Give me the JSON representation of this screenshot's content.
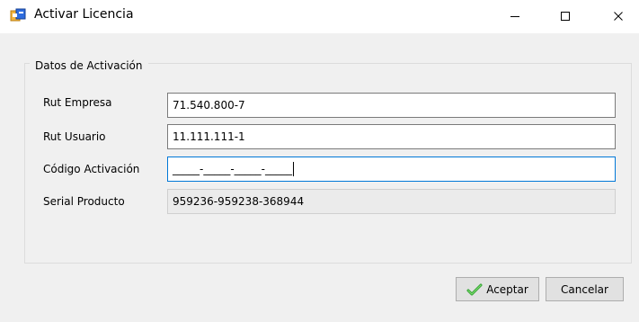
{
  "window": {
    "title": "Activar Licencia",
    "controls": {
      "minimize": "minimize-icon",
      "maximize": "maximize-icon",
      "close": "close-icon"
    }
  },
  "group": {
    "title": "Datos de Activación",
    "fields": {
      "rut_empresa": {
        "label": "Rut Empresa",
        "value": "71.540.800-7"
      },
      "rut_usuario": {
        "label": "Rut Usuario",
        "value": "11.111.111-1"
      },
      "codigo_activacion": {
        "label": "Código Activación",
        "value": "_____-_____-_____-_____"
      },
      "serial_producto": {
        "label": "Serial Producto",
        "value": "959236-959238-368944"
      }
    }
  },
  "buttons": {
    "accept": {
      "label": "Aceptar",
      "icon": "checkmark-icon"
    },
    "cancel": {
      "label": "Cancelar"
    }
  },
  "colors": {
    "window_bg": "#f0f0f0",
    "titlebar_bg": "#ffffff",
    "focus_border": "#0078d7",
    "checkmark": "#2f9e2f"
  }
}
